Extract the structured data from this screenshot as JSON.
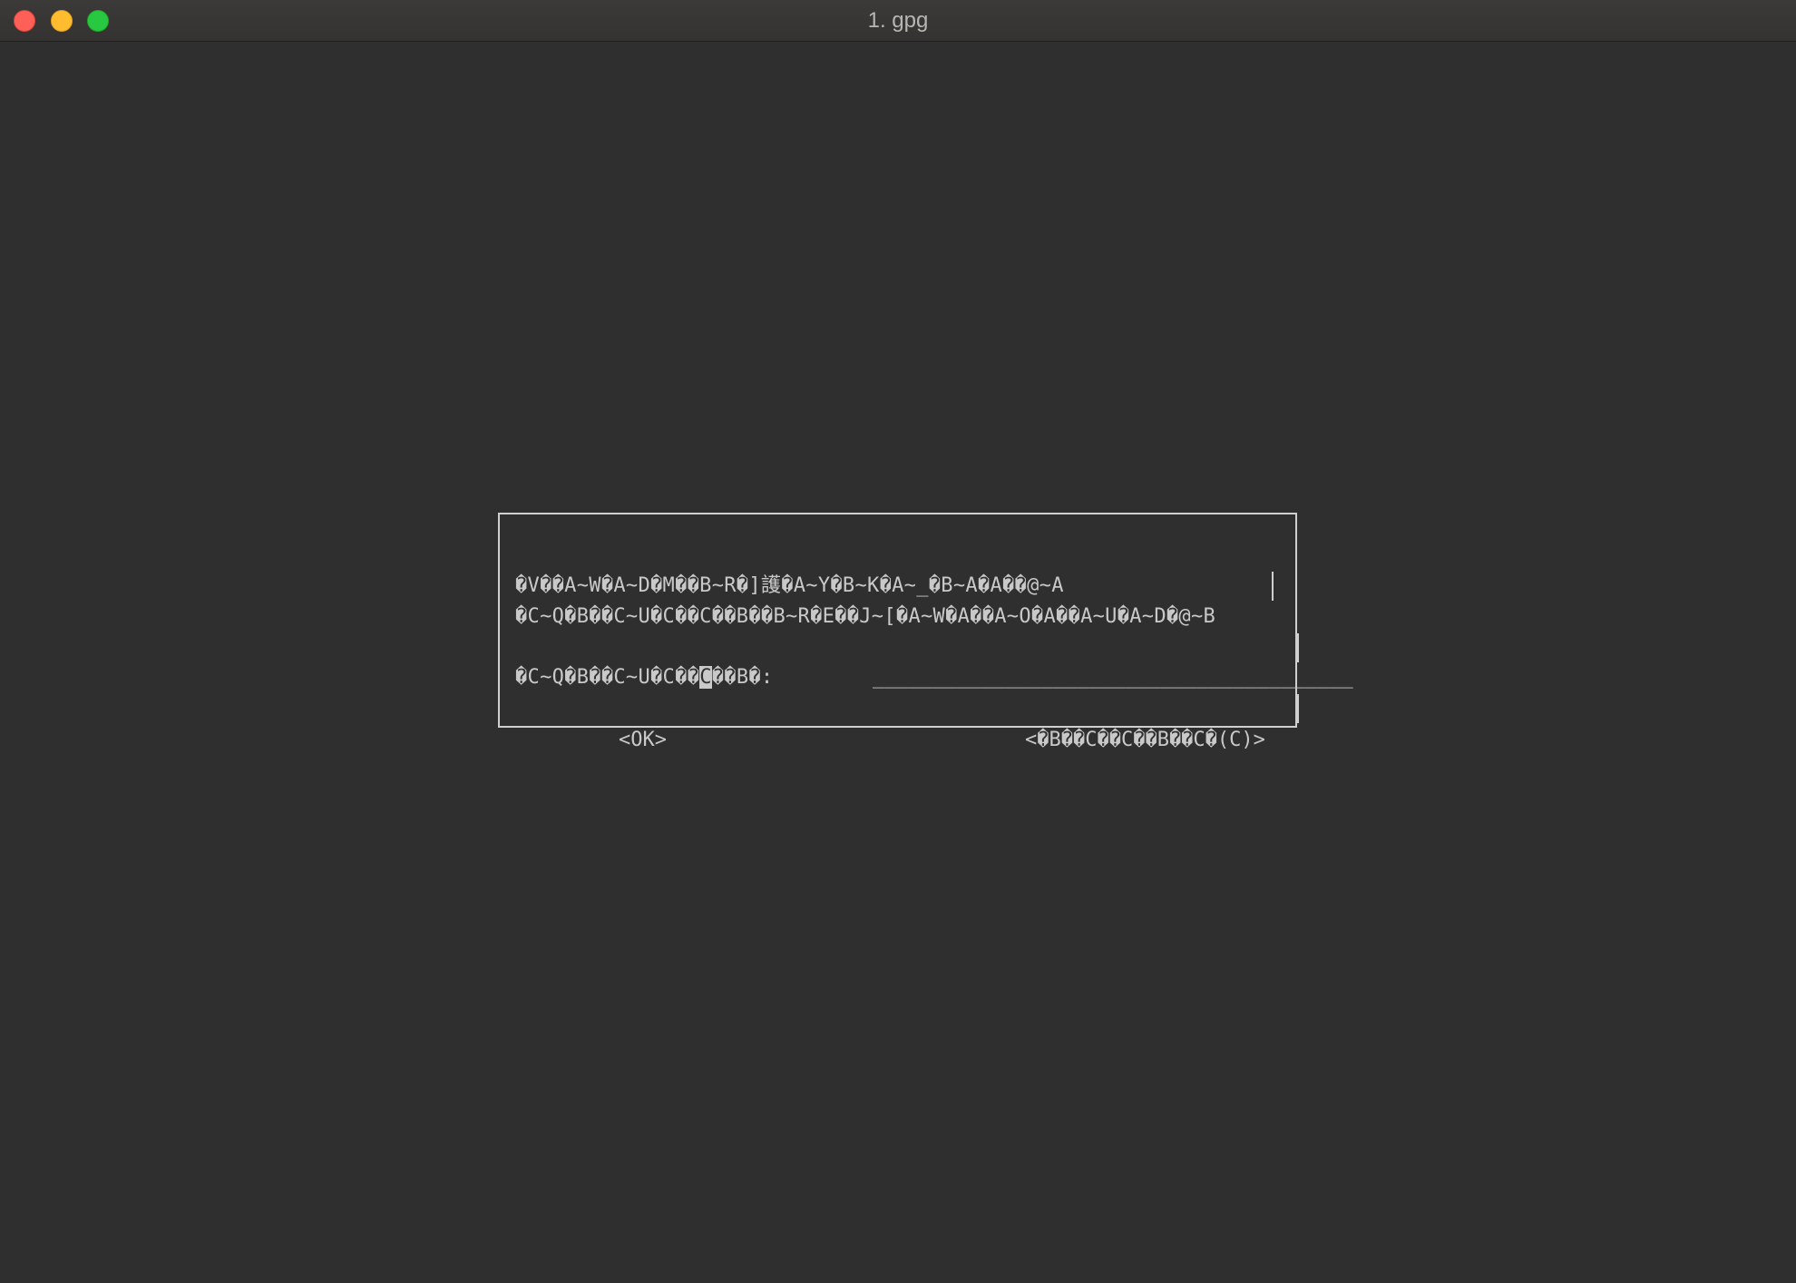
{
  "window": {
    "title": "1. gpg"
  },
  "dialog": {
    "line1": "�V��A~W�A~D�M��B~R�]護�A~Y�B~K�A~_�B~A�A��@~A",
    "line2": "�C~Q�B��C~U�C��C��B��B~R�E��J~[�A~W�A��A~O�A��A~U�A~D�@~B",
    "prompt_before_cursor": "�C~Q�B��C~U�C��",
    "prompt_cursor_char": "C",
    "prompt_after_cursor": "��B�:",
    "input_underline": "________________________________________",
    "ok_button": "<OK>",
    "cancel_button": "<�B��C��C��B��C�(C)>"
  },
  "colors": {
    "background": "#2f2f2f",
    "text": "#c9c9c9",
    "close": "#fe5f57",
    "minimize": "#febc2e",
    "maximize": "#28c840"
  }
}
